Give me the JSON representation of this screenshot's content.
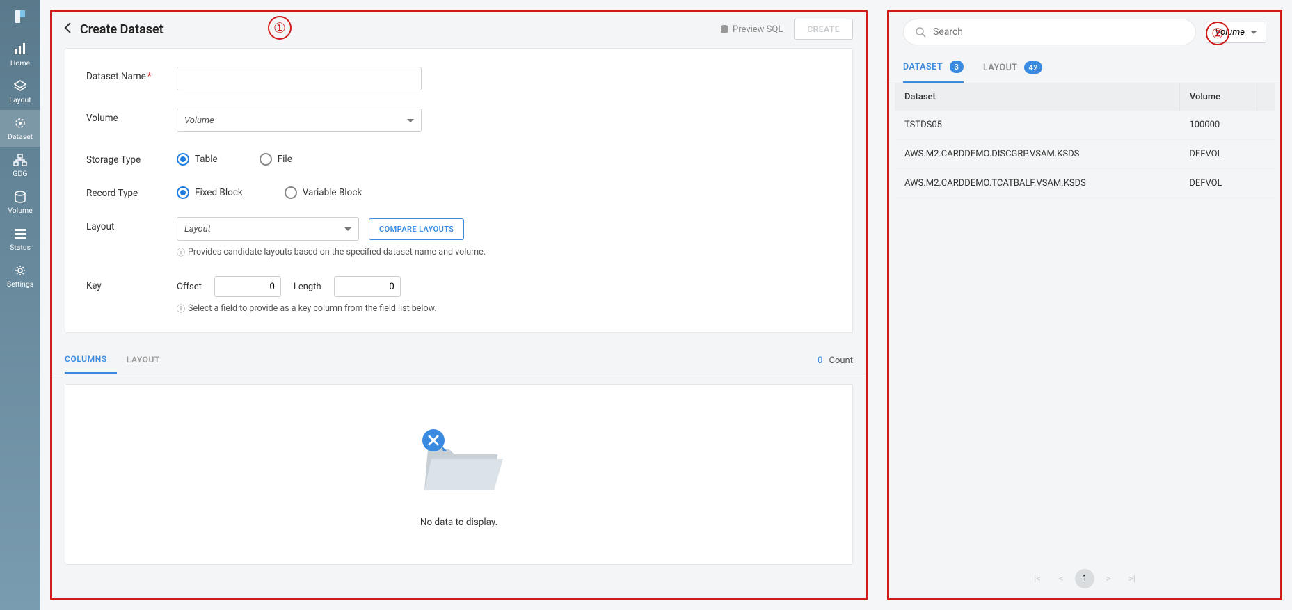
{
  "sidebar": {
    "items": [
      {
        "label": "Home"
      },
      {
        "label": "Layout"
      },
      {
        "label": "Dataset"
      },
      {
        "label": "GDG"
      },
      {
        "label": "Volume"
      },
      {
        "label": "Status"
      },
      {
        "label": "Settings"
      }
    ]
  },
  "leftPanel": {
    "title": "Create Dataset",
    "previewSql": "Preview SQL",
    "createBtn": "CREATE",
    "form": {
      "datasetName": {
        "label": "Dataset Name",
        "value": ""
      },
      "volume": {
        "label": "Volume",
        "placeholder": "Volume"
      },
      "storageType": {
        "label": "Storage Type",
        "opts": [
          "Table",
          "File"
        ],
        "selected": "Table"
      },
      "recordType": {
        "label": "Record Type",
        "opts": [
          "Fixed Block",
          "Variable Block"
        ],
        "selected": "Fixed Block"
      },
      "layout": {
        "label": "Layout",
        "placeholder": "Layout",
        "compareBtn": "COMPARE LAYOUTS",
        "hint": "Provides candidate layouts based on the specified dataset name and volume."
      },
      "key": {
        "label": "Key",
        "offsetLabel": "Offset",
        "offsetValue": "0",
        "lengthLabel": "Length",
        "lengthValue": "0",
        "hint": "Select a field to provide as a key column from the field list below."
      }
    },
    "tabs": {
      "columns": "COLUMNS",
      "layout": "LAYOUT",
      "count": "0",
      "countLabel": "Count"
    },
    "noData": "No data to display."
  },
  "rightPanel": {
    "searchPlaceholder": "Search",
    "volumeFilter": "Volume",
    "tabs": {
      "dataset": "DATASET",
      "datasetCount": "3",
      "layout": "LAYOUT",
      "layoutCount": "42"
    },
    "table": {
      "headers": [
        "Dataset",
        "Volume"
      ],
      "rows": [
        {
          "dataset": "TSTDS05",
          "volume": "100000"
        },
        {
          "dataset": "AWS.M2.CARDDEMO.DISCGRP.VSAM.KSDS",
          "volume": "DEFVOL"
        },
        {
          "dataset": "AWS.M2.CARDDEMO.TCATBALF.VSAM.KSDS",
          "volume": "DEFVOL"
        }
      ]
    },
    "pagination": {
      "current": "1"
    }
  },
  "callouts": {
    "one": "①",
    "two": "②"
  }
}
